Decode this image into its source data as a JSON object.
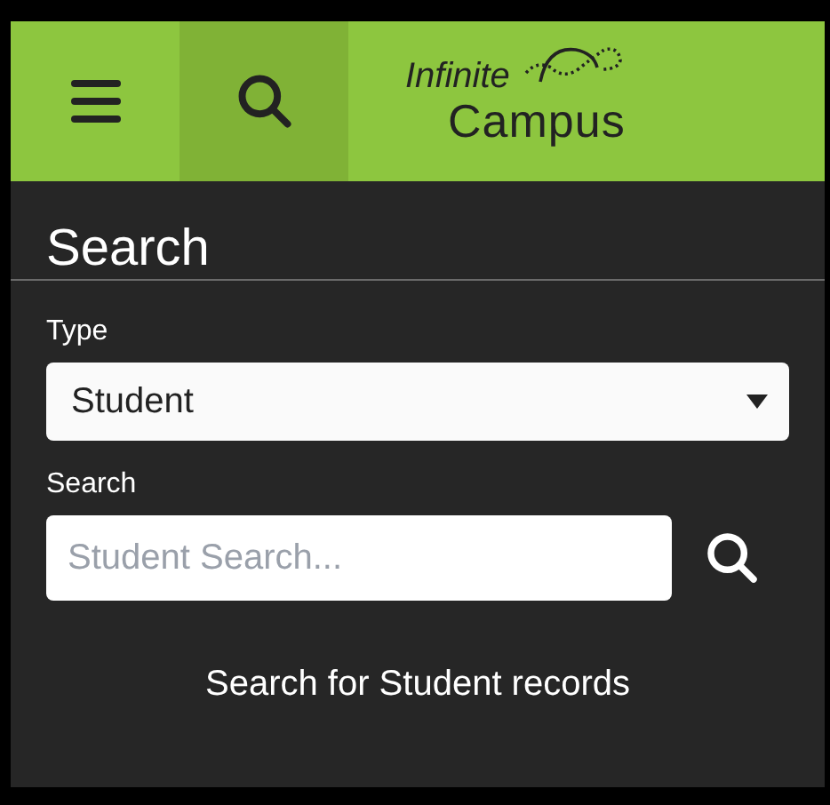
{
  "header": {
    "buttons": [
      {
        "kind": "menu",
        "selected": false
      },
      {
        "kind": "search",
        "selected": true
      }
    ],
    "logo": {
      "line_1": "Infinite",
      "line_2": "Campus"
    }
  },
  "panel": {
    "title": "Search",
    "type_field": {
      "label": "Type",
      "value": "Student"
    },
    "search_field": {
      "label": "Search",
      "placeholder": "Student Search..."
    },
    "hint": "Search for Student records"
  }
}
